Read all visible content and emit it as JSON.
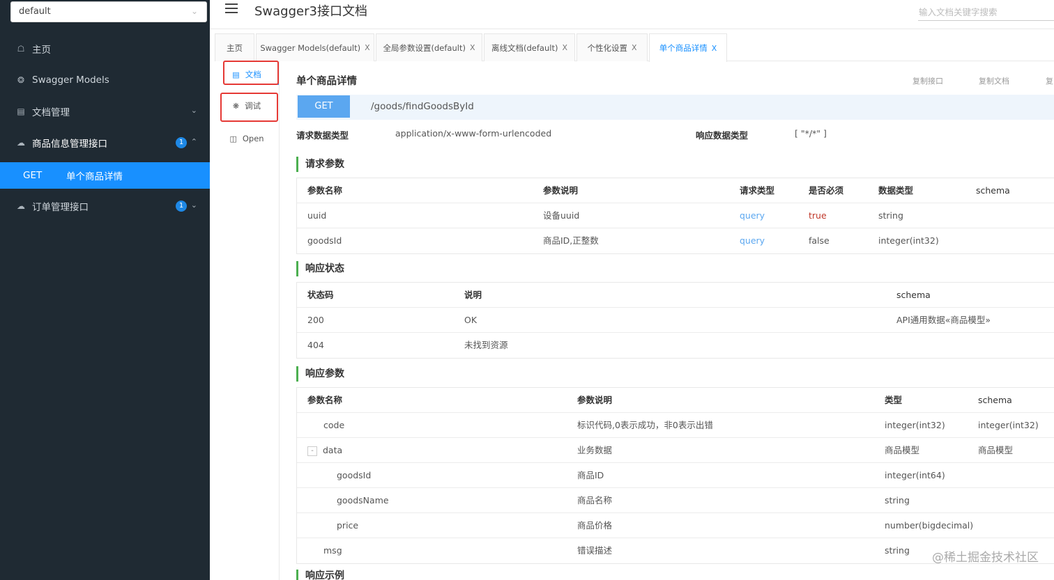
{
  "sidebar": {
    "group_select": "default",
    "items": [
      {
        "label": "主页",
        "icon": "home-icon"
      },
      {
        "label": "Swagger Models",
        "icon": "models-icon"
      },
      {
        "label": "文档管理",
        "icon": "doc-manage-icon"
      },
      {
        "label": "商品信息管理接口",
        "icon": "cloud-icon",
        "badge": "1"
      },
      {
        "label": "订单管理接口",
        "icon": "cloud-icon",
        "badge": "1"
      }
    ],
    "active_item": {
      "method": "GET",
      "label": "单个商品详情"
    }
  },
  "topbar": {
    "title": "Swagger3接口文档",
    "search_placeholder": "输入文档关键字搜索"
  },
  "tabs": [
    {
      "label": "主页",
      "closable": false
    },
    {
      "label": "Swagger Models(default)",
      "closable": true
    },
    {
      "label": "全局参数设置(default)",
      "closable": true
    },
    {
      "label": "离线文档(default)",
      "closable": true
    },
    {
      "label": "个性化设置",
      "closable": true
    },
    {
      "label": "单个商品详情",
      "closable": true,
      "active": true
    }
  ],
  "close_glyph": "X",
  "side_tabs": [
    {
      "label": "文档",
      "icon": "document-icon"
    },
    {
      "label": "调试",
      "icon": "bug-icon"
    },
    {
      "label": "Open",
      "icon": "file-icon"
    }
  ],
  "api": {
    "title": "单个商品详情",
    "actions": [
      "复制接口",
      "复制文档",
      "复"
    ],
    "method": "GET",
    "url": "/goods/findGoodsById",
    "request_type_label": "请求数据类型",
    "request_type": "application/x-www-form-urlencoded",
    "response_type_label": "响应数据类型",
    "response_type": "[ \"*/*\" ]"
  },
  "request_params": {
    "title": "请求参数",
    "headers": [
      "参数名称",
      "参数说明",
      "请求类型",
      "是否必须",
      "数据类型",
      "schema"
    ],
    "rows": [
      [
        "uuid",
        "设备uuid",
        "query",
        "true",
        "string",
        ""
      ],
      [
        "goodsId",
        "商品ID,正整数",
        "query",
        "false",
        "integer(int32)",
        ""
      ]
    ]
  },
  "response_status": {
    "title": "响应状态",
    "headers": [
      "状态码",
      "说明",
      "schema"
    ],
    "rows": [
      [
        "200",
        "OK",
        "API通用数据«商品模型»"
      ],
      [
        "404",
        "未找到资源",
        ""
      ]
    ]
  },
  "response_params": {
    "title": "响应参数",
    "headers": [
      "参数名称",
      "参数说明",
      "类型",
      "schema"
    ],
    "collapse_glyph": "-",
    "rows": [
      [
        "code",
        "标识代码,0表示成功，非0表示出错",
        "integer(int32)",
        "integer(int32)"
      ],
      [
        "data",
        "业务数据",
        "商品模型",
        "商品模型"
      ],
      [
        "goodsId",
        "商品ID",
        "integer(int64)",
        ""
      ],
      [
        "goodsName",
        "商品名称",
        "string",
        ""
      ],
      [
        "price",
        "商品价格",
        "number(bigdecimal)",
        ""
      ],
      [
        "msg",
        "错误描述",
        "string",
        ""
      ]
    ]
  },
  "next_section": "响应示例",
  "watermark": "@稀土掘金技术社区",
  "colors": {
    "sidebar_bg": "#1f2a33",
    "accent": "#1890ff",
    "get_button": "#5ba7f0",
    "section_bar": "#4caf50",
    "highlight_box": "#e53935"
  }
}
